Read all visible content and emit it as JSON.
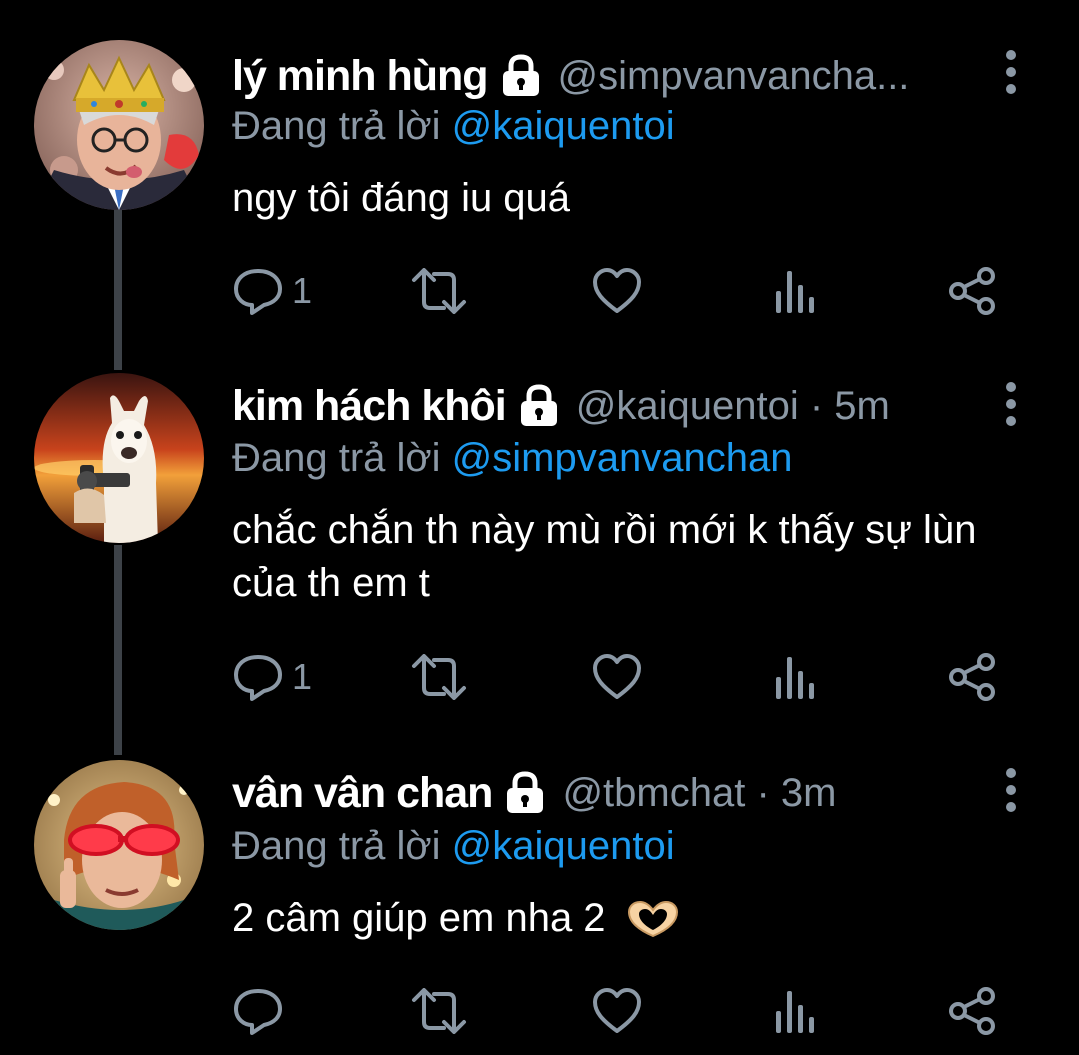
{
  "tweets": [
    {
      "name": "lý minh hùng",
      "handle": "@simpvanvancha...",
      "time": "",
      "reply_prefix": "Đang trả lời ",
      "reply_to": "@kaiquentoi",
      "text": "ngy tôi đáng iu quá",
      "reply_count": "1",
      "avatar": "man-with-crown-avatar"
    },
    {
      "name": "kim hách khôi",
      "handle": "@kaiquentoi · 5m",
      "time": "5m",
      "reply_prefix": "Đang trả lời ",
      "reply_to": "@simpvanvanchan",
      "text": "chắc chắn th này mù rồi mới k thấy sự lùn của th em t",
      "reply_count": "1",
      "avatar": "alpaca-with-gun-avatar"
    },
    {
      "name": "vân vân chan",
      "handle": "@tbmchat · 3m",
      "time": "3m",
      "reply_prefix": "Đang trả lời ",
      "reply_to": "@kaiquentoi",
      "text": "2 câm giúp em nha 2",
      "reply_count": "",
      "avatar": "woman-red-glasses-avatar",
      "emoji": "heart-hands-emoji"
    }
  ],
  "icons": {
    "lock": "lock-icon",
    "more": "more-vertical-icon",
    "reply": "reply-icon",
    "retweet": "retweet-icon",
    "like": "like-icon",
    "stats": "stats-icon",
    "share": "share-icon"
  },
  "colors": {
    "background": "#000000",
    "text": "#ffffff",
    "muted": "#8b98a5",
    "mention": "#1d9bf0",
    "thread_line": "#3d4248"
  }
}
